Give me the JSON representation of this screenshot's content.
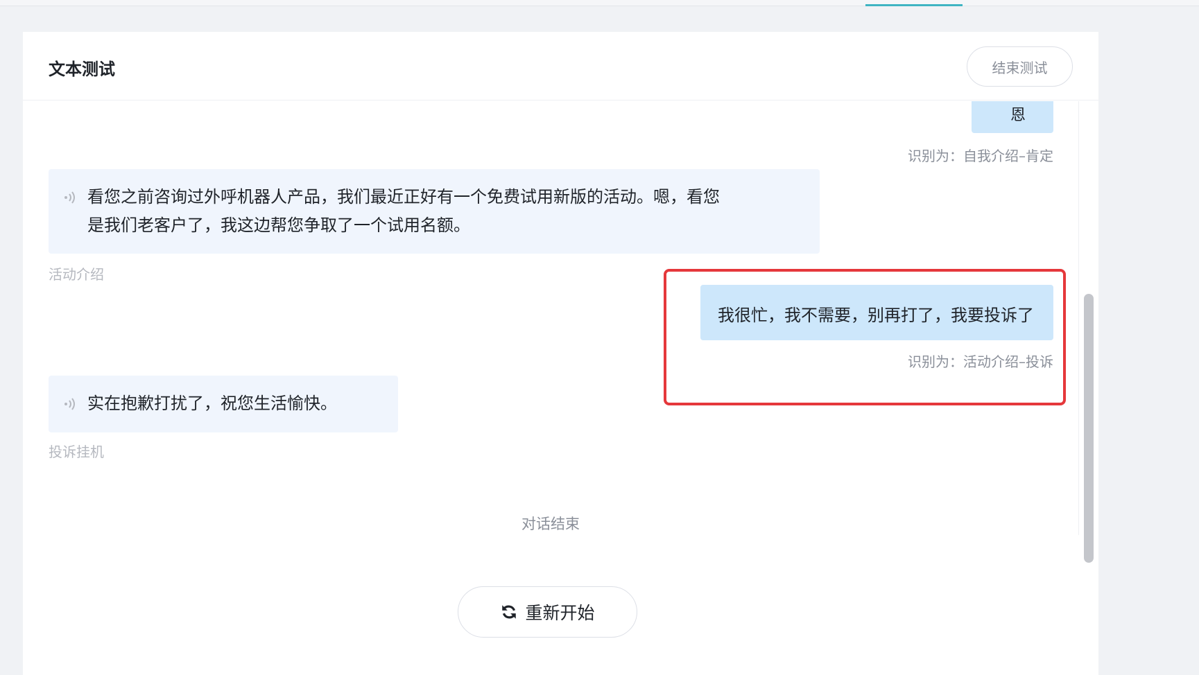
{
  "header": {
    "title": "文本测试",
    "end_button_label": "结束测试"
  },
  "messages": [
    {
      "role": "user",
      "text": "恩",
      "recognized": "识别为：自我介绍–肯定"
    },
    {
      "role": "bot",
      "lines": [
        "看您之前咨询过外呼机器人产品，我们最近正好有一个免费试用新版的活动。嗯，看您",
        "是我们老客户了，我这边帮您争取了一个试用名额。"
      ],
      "node": "活动介绍"
    },
    {
      "role": "user",
      "text": "我很忙，我不需要，别再打了，我要投诉了",
      "recognized": "识别为：活动介绍–投诉",
      "highlighted": true
    },
    {
      "role": "bot",
      "lines": [
        "实在抱歉打扰了，祝您生活愉快。"
      ],
      "node": "投诉挂机"
    }
  ],
  "dialog_end_label": "对话结束",
  "restart_button_label": "重新开始",
  "colors": {
    "accent_tab": "#3fb4c2",
    "user_bubble": "#cde7fb",
    "bot_bubble": "#f0f5fd",
    "highlight": "#e5383b"
  },
  "icons": {
    "bot_voice": "speaker-icon",
    "restart": "refresh-icon"
  }
}
